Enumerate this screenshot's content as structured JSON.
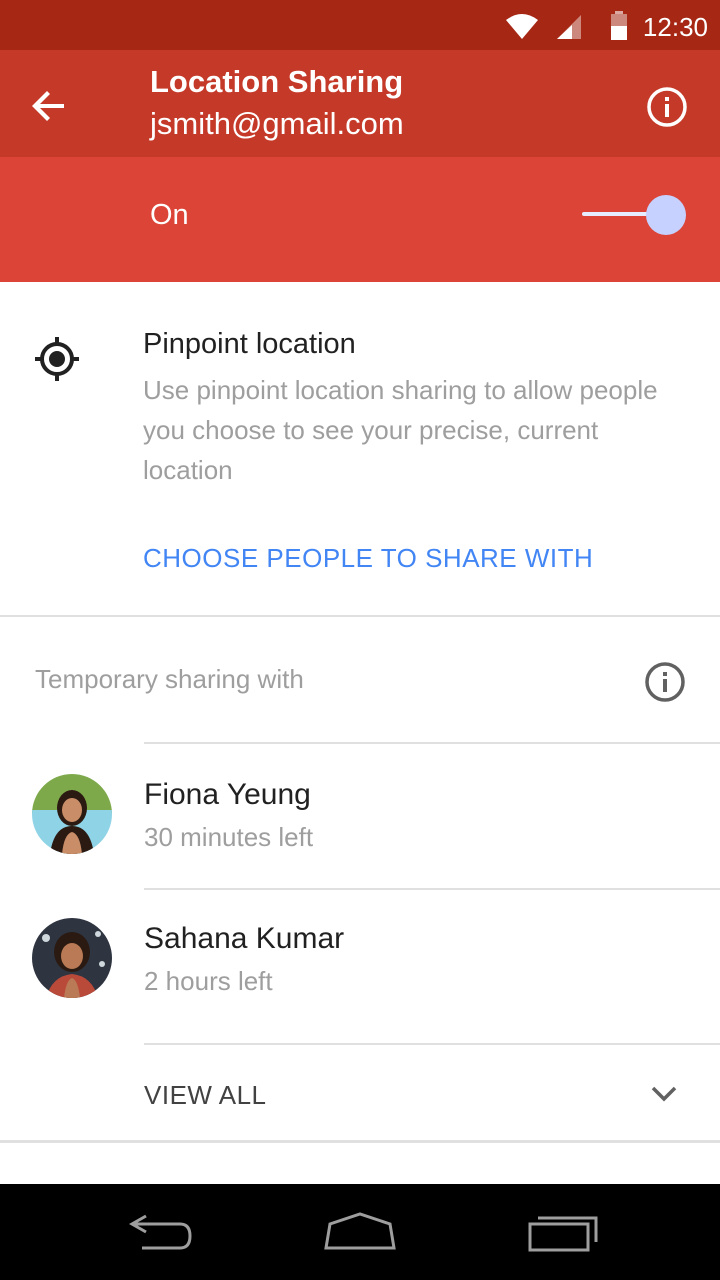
{
  "status_bar": {
    "time": "12:30",
    "icons": [
      "wifi-icon",
      "cell-signal-icon",
      "battery-icon"
    ]
  },
  "app_bar": {
    "title": "Location Sharing",
    "subtitle": "jsmith@gmail.com",
    "back_icon": "arrow-back-icon",
    "info_icon": "info-icon"
  },
  "toggle": {
    "label": "On",
    "state": true,
    "colors": {
      "bar": "#db4437",
      "app_bar": "#c53929",
      "status_bar": "#a52714"
    }
  },
  "pinpoint": {
    "icon": "my-location-icon",
    "heading": "Pinpoint location",
    "description": "Use pinpoint location sharing to allow people you choose to see your precise, current location",
    "action": "CHOOSE PEOPLE TO SHARE WITH",
    "action_color": "#4285f4"
  },
  "temporary": {
    "header": "Temporary sharing with",
    "info_icon": "info-icon",
    "people": [
      {
        "name": "Fiona Yeung",
        "time_left": "30 minutes left"
      },
      {
        "name": "Sahana Kumar",
        "time_left": "2 hours left"
      }
    ],
    "view_all": "VIEW ALL",
    "expand_icon": "chevron-down-icon"
  },
  "nav_bar": {
    "buttons": [
      "back-nav-icon",
      "home-nav-icon",
      "recents-nav-icon"
    ]
  }
}
